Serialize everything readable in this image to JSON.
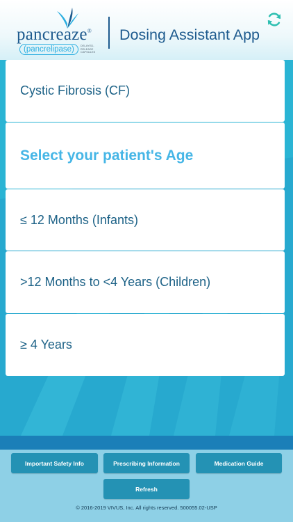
{
  "header": {
    "logo_word": "pancreaze",
    "logo_reg": "®",
    "logo_sub": "(pancrelipase)",
    "logo_fine": "delayed-release capsules",
    "app_title": "Dosing Assistant App"
  },
  "list": {
    "indication": "Cystic Fibrosis (CF)",
    "prompt": "Select your patient's Age",
    "options": [
      "≤ 12 Months (Infants)",
      ">12 Months to <4 Years (Children)",
      "≥ 4 Years"
    ]
  },
  "footer": {
    "buttons": [
      "Important Safety Info",
      "Prescribing Information",
      "Medication Guide",
      "Refresh"
    ],
    "copyright": "© 2016-2019 VIVUS, Inc. All rights reserved. 500055.02-USP"
  },
  "colors": {
    "brand_blue": "#1d5a8e",
    "accent_cyan": "#46b6e6",
    "background": "#29b3d3",
    "footer_button": "#2492b4"
  },
  "icons": {
    "refresh": "refresh-icon",
    "logo": "leaf-logo-icon"
  }
}
